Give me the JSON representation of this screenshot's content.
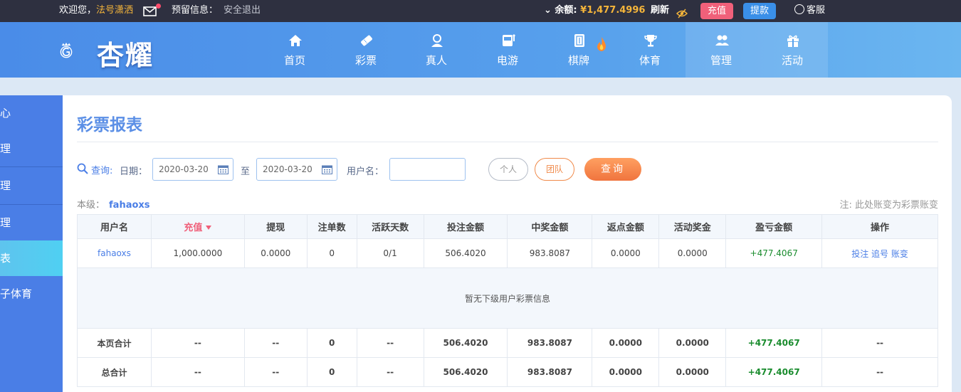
{
  "topbar": {
    "welcome": "欢迎您，",
    "nickname": "法号潇洒",
    "reserved_label": "预留信息：",
    "logout": "安全退出",
    "balance_label": "余额:",
    "balance_value": "¥1,477.4996",
    "refresh": "刷新",
    "recharge": "充值",
    "withdraw": "提款",
    "service": "客服"
  },
  "nav": {
    "logo_text": "杏耀",
    "items": [
      {
        "label": "首页",
        "icon": "home-icon"
      },
      {
        "label": "彩票",
        "icon": "lottery-icon"
      },
      {
        "label": "真人",
        "icon": "live-dealer-icon"
      },
      {
        "label": "电游",
        "icon": "slot-icon"
      },
      {
        "label": "棋牌",
        "icon": "cards-icon"
      },
      {
        "label": "体育",
        "icon": "trophy-icon"
      },
      {
        "label": "管理",
        "icon": "users-icon",
        "active": true
      },
      {
        "label": "活动",
        "icon": "gift-icon"
      }
    ]
  },
  "sidebar": {
    "items": [
      {
        "label": "心"
      },
      {
        "label": "理"
      },
      {
        "label": "理"
      },
      {
        "label": "理"
      },
      {
        "label": "表",
        "active": true
      },
      {
        "label": "子体育"
      }
    ]
  },
  "page": {
    "title": "彩票报表",
    "query_label": "查询:",
    "date_label": "日期：",
    "date_from": "2020-03-20",
    "to_label": "至",
    "date_to": "2020-03-20",
    "username_label": "用户名：",
    "username_value": "",
    "btn_person": "个人",
    "btn_team": "团队",
    "btn_search": "查询",
    "level_label": "本级：",
    "level_user": "fahaoxs",
    "note": "注: 此处账变为彩票账变"
  },
  "table": {
    "headers": [
      "用户名",
      "充值",
      "提现",
      "注单数",
      "活跃天数",
      "投注金额",
      "中奖金额",
      "返点金额",
      "活动奖金",
      "盈亏金额",
      "操作"
    ],
    "row": [
      "fahaoxs",
      "1,000.0000",
      "0.0000",
      "0",
      "0/1",
      "506.4020",
      "983.8087",
      "0.0000",
      "0.0000",
      "+477.4067"
    ],
    "ops": [
      "投注",
      "追号",
      "账变"
    ],
    "empty_text": "暂无下级用户彩票信息",
    "page_total": [
      "本页合计",
      "--",
      "--",
      "0",
      "--",
      "506.4020",
      "983.8087",
      "0.0000",
      "0.0000",
      "+477.4067",
      "--"
    ],
    "grand_total": [
      "总合计",
      "--",
      "--",
      "0",
      "--",
      "506.4020",
      "983.8087",
      "0.0000",
      "0.0000",
      "+477.4067",
      "--"
    ]
  },
  "colors": {
    "accent": "#4a7ee6",
    "nav_bg": "#57a0ec",
    "topbar_bg": "#2e3040",
    "recharge": "#f0607a",
    "withdraw": "#3a8fe8",
    "gold": "#f5b53a",
    "positive": "#1a8c2e",
    "search_btn": "#f0743e"
  }
}
